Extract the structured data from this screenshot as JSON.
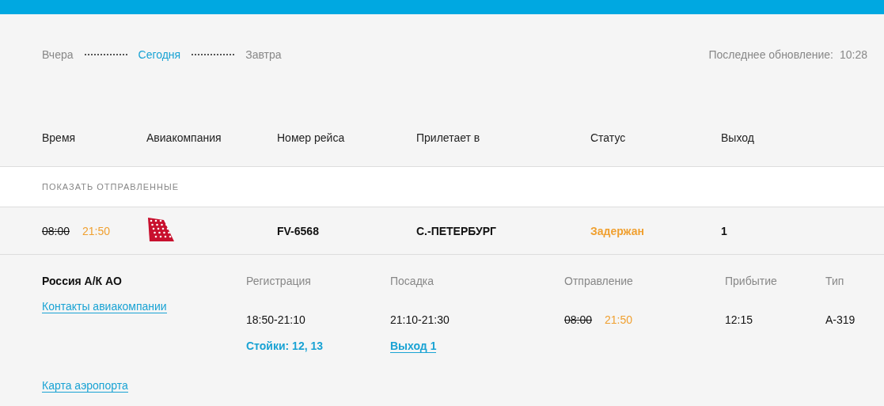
{
  "day_tabs": [
    {
      "label": "Вчера",
      "selected": false
    },
    {
      "label": "Сегодня",
      "selected": true
    },
    {
      "label": "Завтра",
      "selected": false
    }
  ],
  "last_update": {
    "label": "Последнее обновление:",
    "time": "10:28"
  },
  "table": {
    "columns": [
      "Время",
      "Авиакомпания",
      "Номер рейса",
      "Прилетает в",
      "Статус",
      "Выход"
    ],
    "show_departed": "ПОКАЗАТЬ ОТПРАВЛЕННЫЕ",
    "rows": [
      {
        "scheduled_time": "08:00",
        "actual_time": "21:50",
        "flight": "FV-6568",
        "destination": "С.-ПЕТЕРБУРГ",
        "status": {
          "label": "Задержан",
          "kind": "delayed"
        },
        "gate": "1",
        "details": {
          "airline": "Россия А/К АО",
          "contacts_link": "Контакты авиакомпании",
          "map_link": "Карта аэропорта",
          "columns": [
            {
              "kind": "plain",
              "heading": "Регистрация",
              "value": "18:50-21:10",
              "note": {
                "kind": "text",
                "text": "Стойки: 12, 13"
              }
            },
            {
              "kind": "plain",
              "heading": "Посадка",
              "value": "21:10-21:30",
              "note": {
                "kind": "link",
                "text": "Выход 1"
              }
            },
            {
              "kind": "times",
              "heading": "Отправление",
              "scheduled": "08:00",
              "actual": "21:50"
            },
            {
              "kind": "plain",
              "heading": "Прибытие",
              "value": "12:15"
            },
            {
              "kind": "plain",
              "heading": "Тип",
              "value": "A-319"
            }
          ]
        }
      }
    ]
  }
}
